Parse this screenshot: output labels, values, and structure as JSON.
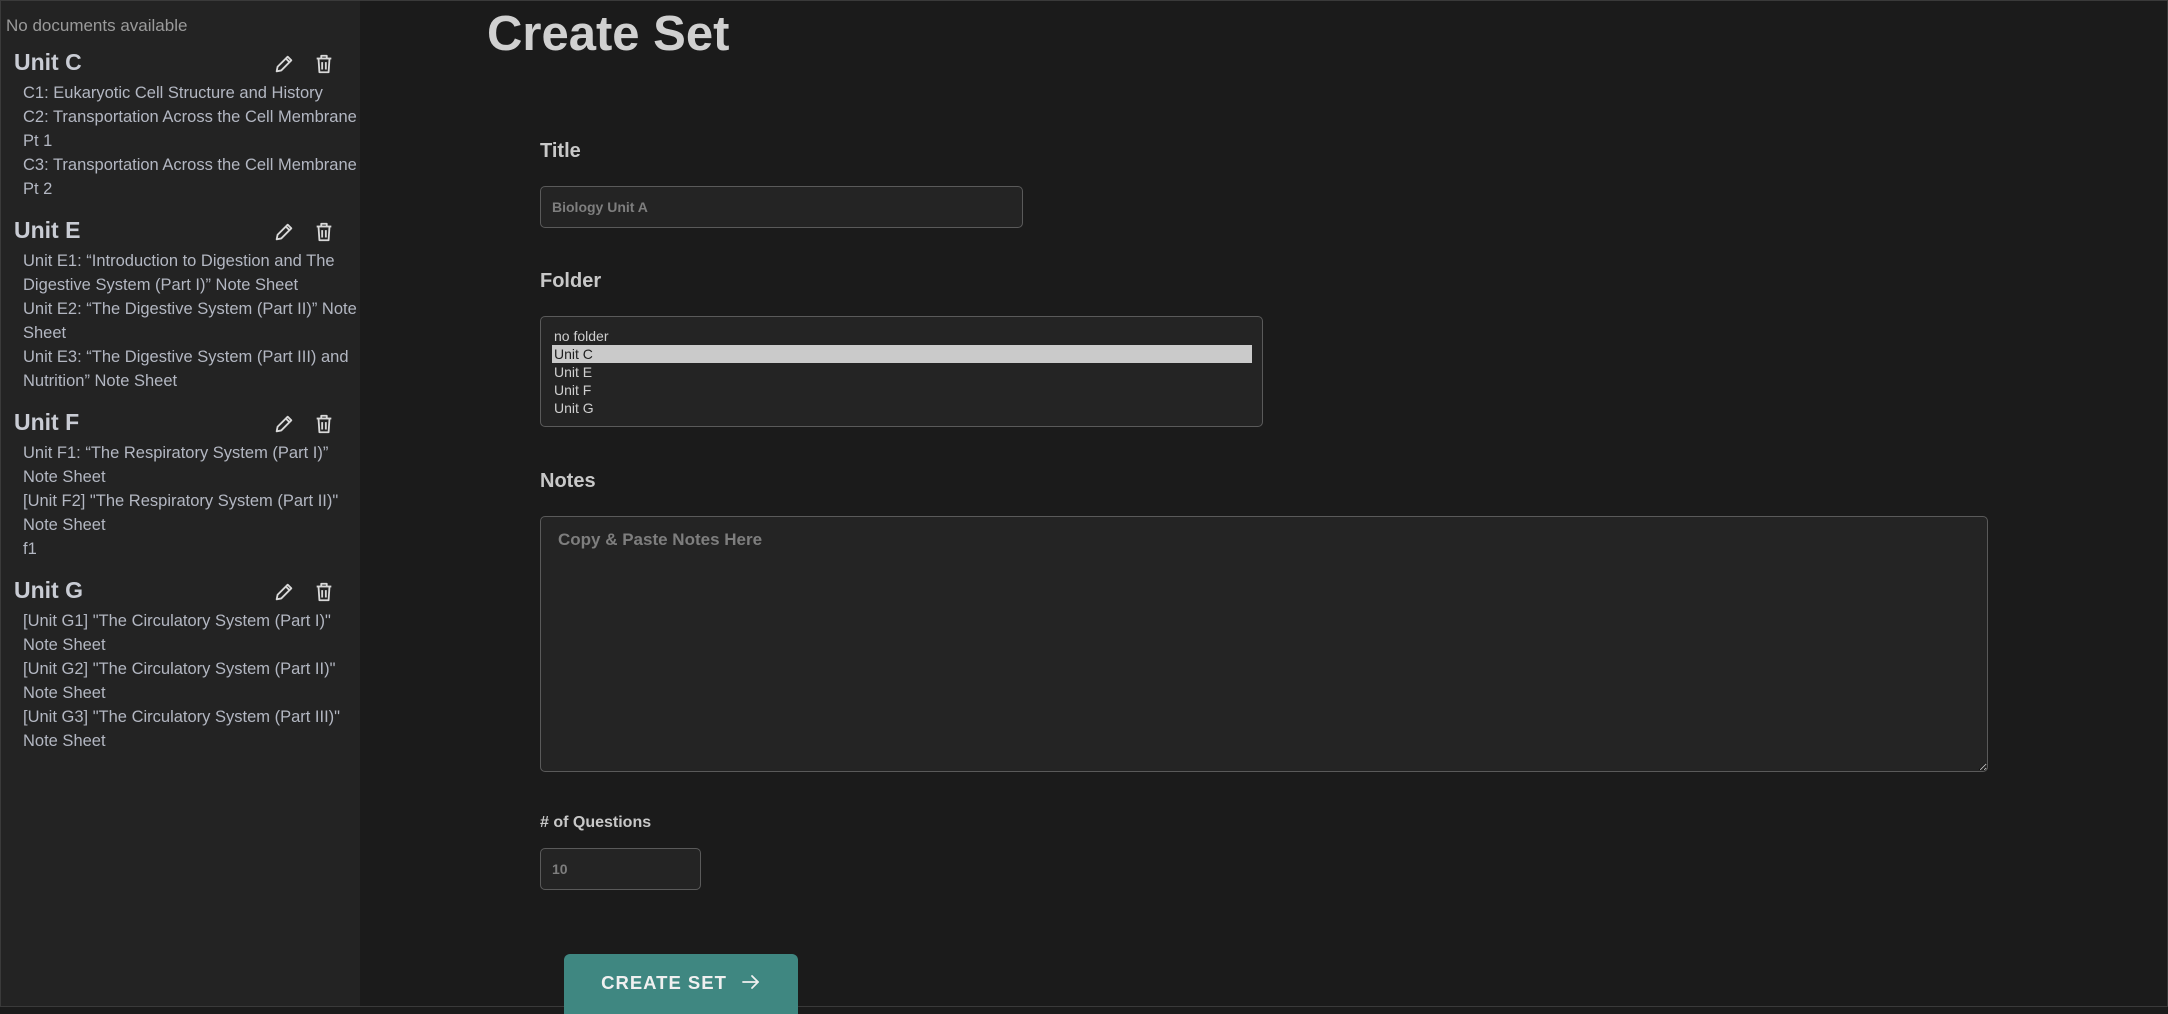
{
  "sidebar": {
    "no_documents": "No documents available",
    "folders": [
      {
        "name": "Unit C",
        "documents": [
          "C1: Eukaryotic Cell Structure and History",
          "C2: Transportation Across the Cell Membrane Pt 1",
          "C3: Transportation Across the Cell Membrane Pt 2"
        ]
      },
      {
        "name": "Unit E",
        "documents": [
          "Unit E1: “Introduction to Digestion and The Digestive System (Part I)” Note Sheet",
          "Unit E2: “The Digestive System (Part II)” Note Sheet",
          "Unit E3: “The Digestive System (Part III) and Nutrition” Note Sheet"
        ]
      },
      {
        "name": "Unit F",
        "documents": [
          "Unit F1: “The Respiratory System (Part I)” Note Sheet",
          "[Unit F2] \"The Respiratory System (Part II)\" Note Sheet",
          "f1"
        ]
      },
      {
        "name": "Unit G",
        "documents": [
          "[Unit G1] \"The Circulatory System (Part I)\" Note Sheet",
          "[Unit G2] \"The Circulatory System (Part II)\" Note Sheet",
          "[Unit G3] \"The Circulatory System (Part III)\" Note Sheet"
        ]
      }
    ]
  },
  "main": {
    "title": "Create Set",
    "title_field": {
      "label": "Title",
      "value": "",
      "placeholder": "Biology Unit A"
    },
    "folder_field": {
      "label": "Folder",
      "options": [
        "no folder",
        "Unit C",
        "Unit E",
        "Unit F",
        "Unit G"
      ],
      "selected": "Unit C"
    },
    "notes_field": {
      "label": "Notes",
      "value": "",
      "placeholder": "Copy & Paste Notes Here"
    },
    "questions_field": {
      "label": "# of Questions",
      "value": "",
      "placeholder": "10"
    },
    "create_button": {
      "label": "CREATE SET",
      "icon": "arrow-right-icon"
    }
  },
  "icons": {
    "edit": "pencil-icon",
    "delete": "trash-icon"
  },
  "colors": {
    "background": "#1b1b1b",
    "sidebar": "#232323",
    "accent": "#3f8781",
    "selected_option": "#cacaca"
  }
}
